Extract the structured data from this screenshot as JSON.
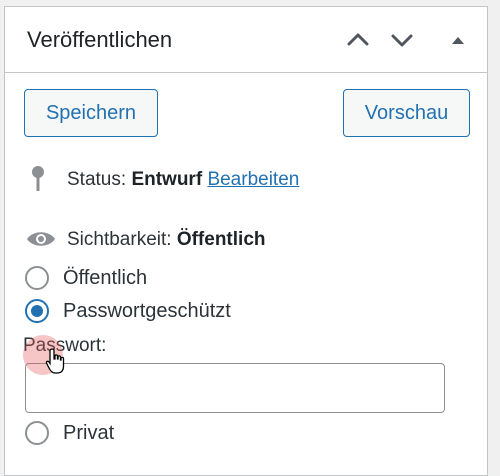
{
  "panel": {
    "title": "Veröffentlichen",
    "move_up_icon": "chevron-up-icon",
    "move_down_icon": "chevron-down-icon",
    "toggle_icon": "triangle-up-icon"
  },
  "actions": {
    "save_label": "Speichern",
    "preview_label": "Vorschau"
  },
  "status": {
    "icon": "pin-icon",
    "label": "Status:",
    "value": "Entwurf",
    "edit_link": "Bearbeiten"
  },
  "visibility": {
    "icon": "eye-icon",
    "label": "Sichtbarkeit:",
    "value": "Öffentlich",
    "options": [
      {
        "label": "Öffentlich",
        "checked": false
      },
      {
        "label": "Passwortgeschützt",
        "checked": true
      },
      {
        "label": "Privat",
        "checked": false
      }
    ],
    "password_label": "Passwort:",
    "password_value": ""
  },
  "colors": {
    "accent": "#2271b1",
    "text": "#1d2327",
    "border": "#c3c4c7"
  },
  "cursor": "hand-pointer-icon"
}
